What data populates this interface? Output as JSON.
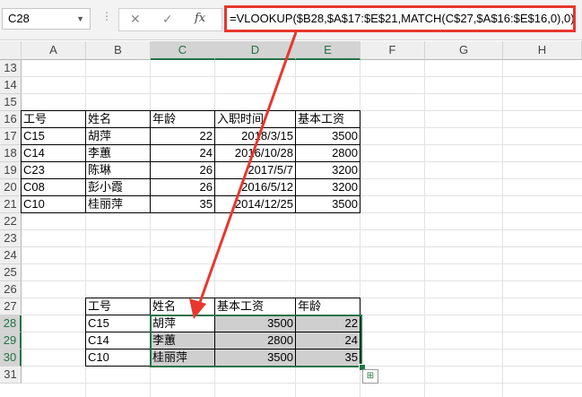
{
  "formula_bar": {
    "name_box": "C28",
    "cancel_icon": "✕",
    "enter_icon": "✓",
    "fx_label": "fx",
    "formula": "=VLOOKUP($B28,$A$17:$E$21,MATCH(C$27,$A$16:$E$16,0),0)"
  },
  "columns": [
    "A",
    "B",
    "C",
    "D",
    "E",
    "F",
    "G",
    "H"
  ],
  "active_columns": [
    "C",
    "D",
    "E"
  ],
  "rows": [
    "13",
    "14",
    "15",
    "16",
    "17",
    "18",
    "19",
    "20",
    "21",
    "22",
    "23",
    "24",
    "25",
    "26",
    "27",
    "28",
    "29",
    "30",
    "31"
  ],
  "active_rows": [
    "28",
    "29",
    "30"
  ],
  "source_table": {
    "headers": [
      "工号",
      "姓名",
      "年龄",
      "入职时间",
      "基本工资"
    ],
    "rows": [
      [
        "C15",
        "胡萍",
        "22",
        "2018/3/15",
        "3500"
      ],
      [
        "C14",
        "李蕙",
        "24",
        "2016/10/28",
        "2800"
      ],
      [
        "C23",
        "陈琳",
        "26",
        "2017/5/7",
        "3200"
      ],
      [
        "C08",
        "彭小霞",
        "26",
        "2016/5/12",
        "3200"
      ],
      [
        "C10",
        "桂丽萍",
        "35",
        "2014/12/25",
        "3500"
      ]
    ]
  },
  "lookup_table": {
    "headers": [
      "工号",
      "姓名",
      "基本工资",
      "年龄"
    ],
    "rows": [
      [
        "C15",
        "胡萍",
        "3500",
        "22"
      ],
      [
        "C14",
        "李蕙",
        "2800",
        "24"
      ],
      [
        "C10",
        "桂丽萍",
        "3500",
        "35"
      ]
    ]
  },
  "colors": {
    "accent": "#217346",
    "annotation": "#e8372e",
    "selection": "#cfcfcf"
  }
}
